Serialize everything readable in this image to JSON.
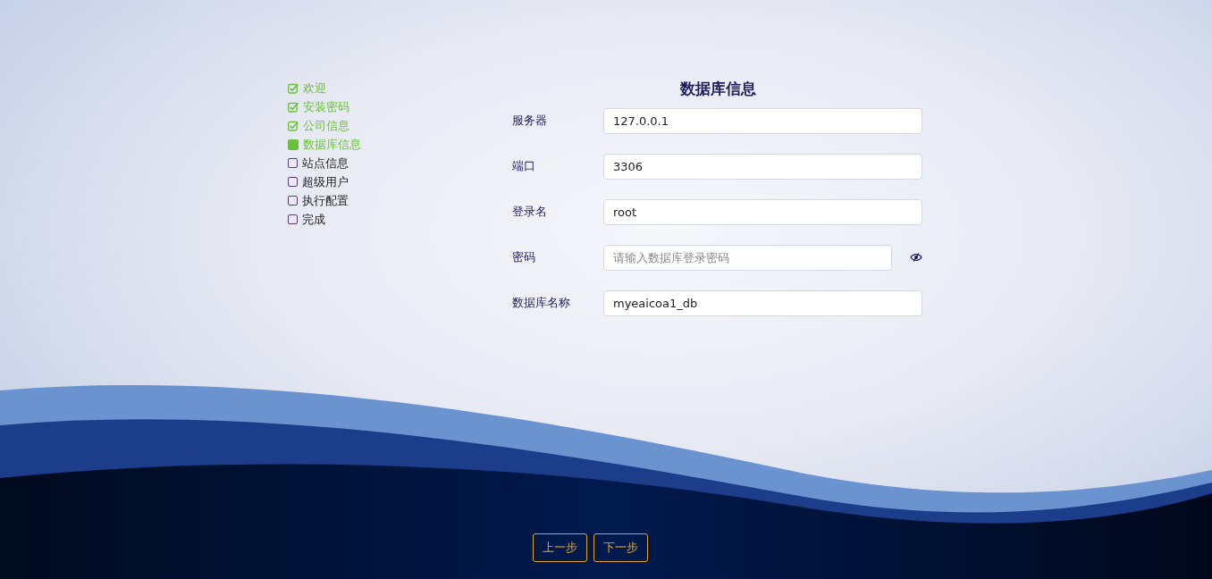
{
  "steps": [
    {
      "label": "欢迎",
      "kind": "done"
    },
    {
      "label": "安装密码",
      "kind": "done"
    },
    {
      "label": "公司信息",
      "kind": "done"
    },
    {
      "label": "数据库信息",
      "kind": "current"
    },
    {
      "label": "站点信息",
      "kind": "pending"
    },
    {
      "label": "超级用户",
      "kind": "pending"
    },
    {
      "label": "执行配置",
      "kind": "pending"
    },
    {
      "label": "完成",
      "kind": "pending"
    }
  ],
  "form": {
    "title": "数据库信息",
    "fields": [
      {
        "label": "服务器",
        "kind": "text",
        "value": "127.0.0.1"
      },
      {
        "label": "端口",
        "kind": "text",
        "value": "3306"
      },
      {
        "label": "登录名",
        "kind": "text",
        "value": "root"
      },
      {
        "label": "密码",
        "kind": "password",
        "placeholder": "请输入数据库登录密码"
      },
      {
        "label": "数据库名称",
        "kind": "text",
        "value": "myeaicoa1_db"
      }
    ]
  },
  "buttons": [
    "上一步",
    "下一步"
  ]
}
